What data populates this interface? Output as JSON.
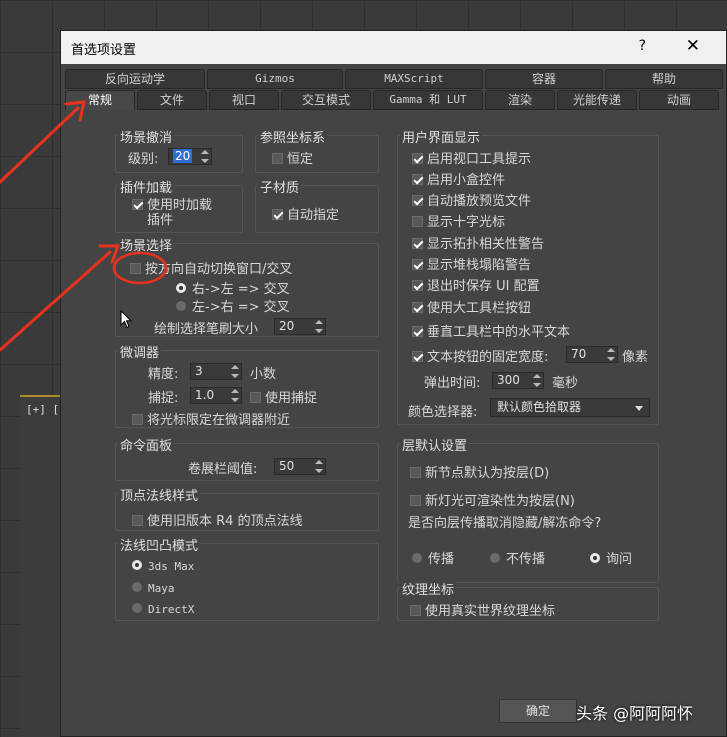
{
  "dialog": {
    "title": "首选项设置",
    "help_glyph": "?",
    "close_glyph": "✕"
  },
  "tabs_top": [
    "反向运动学",
    "Gizmos",
    "MAXScript",
    "容器",
    "帮助"
  ],
  "tabs_bottom": [
    "常规",
    "文件",
    "视口",
    "交互模式",
    "Gamma 和 LUT",
    "渲染",
    "光能传递",
    "动画"
  ],
  "scene_undo": {
    "title": "场景撤消",
    "level_label": "级别:",
    "level_value": "20"
  },
  "ref_coord": {
    "title": "参照坐标系",
    "constant_label": "恒定",
    "constant_checked": false
  },
  "plugin_load": {
    "title": "插件加载",
    "load_on_use_line1": "使用时加载",
    "load_on_use_line2": "插件",
    "checked": true
  },
  "sub_material": {
    "title": "子材质",
    "auto_assign_label": "自动指定",
    "checked": true
  },
  "scene_select": {
    "title": "场景选择",
    "auto_switch_label": "按方向自动切换窗口/交叉",
    "auto_switch_checked": false,
    "rtl_label": "右->左 => 交叉",
    "ltr_label": "左->右 => 交叉",
    "brush_size_label": "绘制选择笔刷大小",
    "brush_size_value": "20"
  },
  "spinner_group": {
    "title": "微调器",
    "precision_label": "精度:",
    "precision_value": "3",
    "decimal_label": "小数",
    "snap_label": "捕捉:",
    "snap_value": "1.0",
    "use_snap_label": "使用捕捉",
    "use_snap_checked": false,
    "cursor_limit_label": "将光标限定在微调器附近",
    "cursor_limit_checked": false
  },
  "command_panel": {
    "title": "命令面板",
    "rollout_label": "卷展栏阈值:",
    "rollout_value": "50"
  },
  "vertex_normal": {
    "title": "顶点法线样式",
    "legacy_label": "使用旧版本 R4 的顶点法线",
    "checked": false
  },
  "bump_mode": {
    "title": "法线凹凸模式",
    "options": [
      "3ds Max",
      "Maya",
      "DirectX"
    ],
    "selected": 0
  },
  "ui_display": {
    "title": "用户界面显示",
    "items": [
      {
        "label": "启用视口工具提示",
        "checked": true
      },
      {
        "label": "启用小盒控件",
        "checked": true
      },
      {
        "label": "自动播放预览文件",
        "checked": true
      },
      {
        "label": "显示十字光标",
        "checked": false
      },
      {
        "label": "显示拓扑相关性警告",
        "checked": true
      },
      {
        "label": "显示堆栈塌陷警告",
        "checked": true
      },
      {
        "label": "退出时保存 UI 配置",
        "checked": true
      },
      {
        "label": "使用大工具栏按钮",
        "checked": true
      },
      {
        "label": "垂直工具栏中的水平文本",
        "checked": true
      },
      {
        "label": "文本按钮的固定宽度:",
        "checked": true
      }
    ],
    "fixed_width_value": "70",
    "fixed_width_unit": "像素",
    "flyout_label": "弹出时间:",
    "flyout_value": "300",
    "flyout_unit": "毫秒",
    "color_picker_label": "颜色选择器:",
    "color_picker_value": "默认颜色拾取器"
  },
  "layer_defaults": {
    "title": "层默认设置",
    "new_nodes_label": "新节点默认为按层(D)",
    "new_nodes_checked": false,
    "light_render_label": "新灯光可渲染性为按层(N)",
    "light_render_checked": false,
    "propagate_question": "是否向层传播取消隐藏/解冻命令?",
    "options": [
      "传播",
      "不传播",
      "询问"
    ],
    "selected": 2
  },
  "texture_coord": {
    "title": "纹理坐标",
    "real_world_label": "使用真实世界纹理坐标",
    "checked": false
  },
  "ok_label": "确定",
  "viewport_label": "[+] [I",
  "watermark": "头条 @阿阿阿怀",
  "colors": {
    "annotation": "#e8321e",
    "highlight": "#2f6ed4"
  }
}
